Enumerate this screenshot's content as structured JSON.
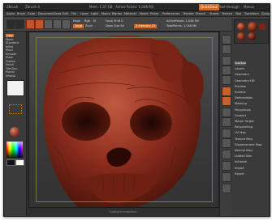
{
  "titlebar": {
    "app_title": "ZBrush",
    "doc_title": "Zbrush 4",
    "center_text": "Mem: 1.37 GB · Active Points: 1.046 Mil",
    "btn_quicksave": "QuickSave",
    "btn_seethrough": "See-through",
    "btn_menus": "Menus"
  },
  "menubar": {
    "items": [
      "Alpha",
      "Brush",
      "Color",
      "Document",
      "Draw",
      "Edit",
      "File",
      "Layer",
      "Light",
      "Macro",
      "Marker",
      "Material",
      "Movie",
      "Picker",
      "Preferences",
      "Render",
      "Stencil",
      "Stroke",
      "Texture",
      "Tool",
      "Transform",
      "Zplugin",
      "Zscript"
    ]
  },
  "toolbar": {
    "btn_edit": "Edit",
    "btn_draw": "Draw",
    "btn_move": "Move",
    "btn_scale": "Scale",
    "btn_rotate": "Rotate",
    "chip_mrgb": "Mrgb",
    "chip_rgb": "Rgb",
    "chip_m": "M",
    "chip_zadd": "Zadd",
    "chip_zsub": "Zsub",
    "chip_focal": "Focal Shift 0",
    "chip_draw_size": "Draw Size 64",
    "chip_z_intensity": "Z Intensity 25",
    "chip_active_points": "ActivePoints: 1.046 Mil",
    "chip_total_points": "TotalPoints: 1.046 Mil"
  },
  "left_shelf": {
    "items": [
      "Clay",
      "Move",
      "Standard",
      "Inflat",
      "Pinch",
      "Smooth",
      "Slash",
      "Flatten",
      "Polish",
      "TrimDyn",
      "Planar",
      "hPolish"
    ],
    "active_index": 0
  },
  "right_tray": {
    "header": "SubTool",
    "items": [
      "SubTool",
      "Layers",
      "Geometry",
      "Geometry HD",
      "Preview",
      "Surface",
      "Deformation",
      "Masking",
      "Polygroups",
      "Contact",
      "Morph Target",
      "Polypainting",
      "UV Map",
      "Texture Map",
      "Displacement Map",
      "Normal Map",
      "Unified Skin",
      "Initialize",
      "Import",
      "Export"
    ],
    "highlight_index": 0
  },
  "canvas_footer": "Spotlight projection",
  "colors": {
    "accent": "#d06a25",
    "skin": "#8a2b1c"
  }
}
